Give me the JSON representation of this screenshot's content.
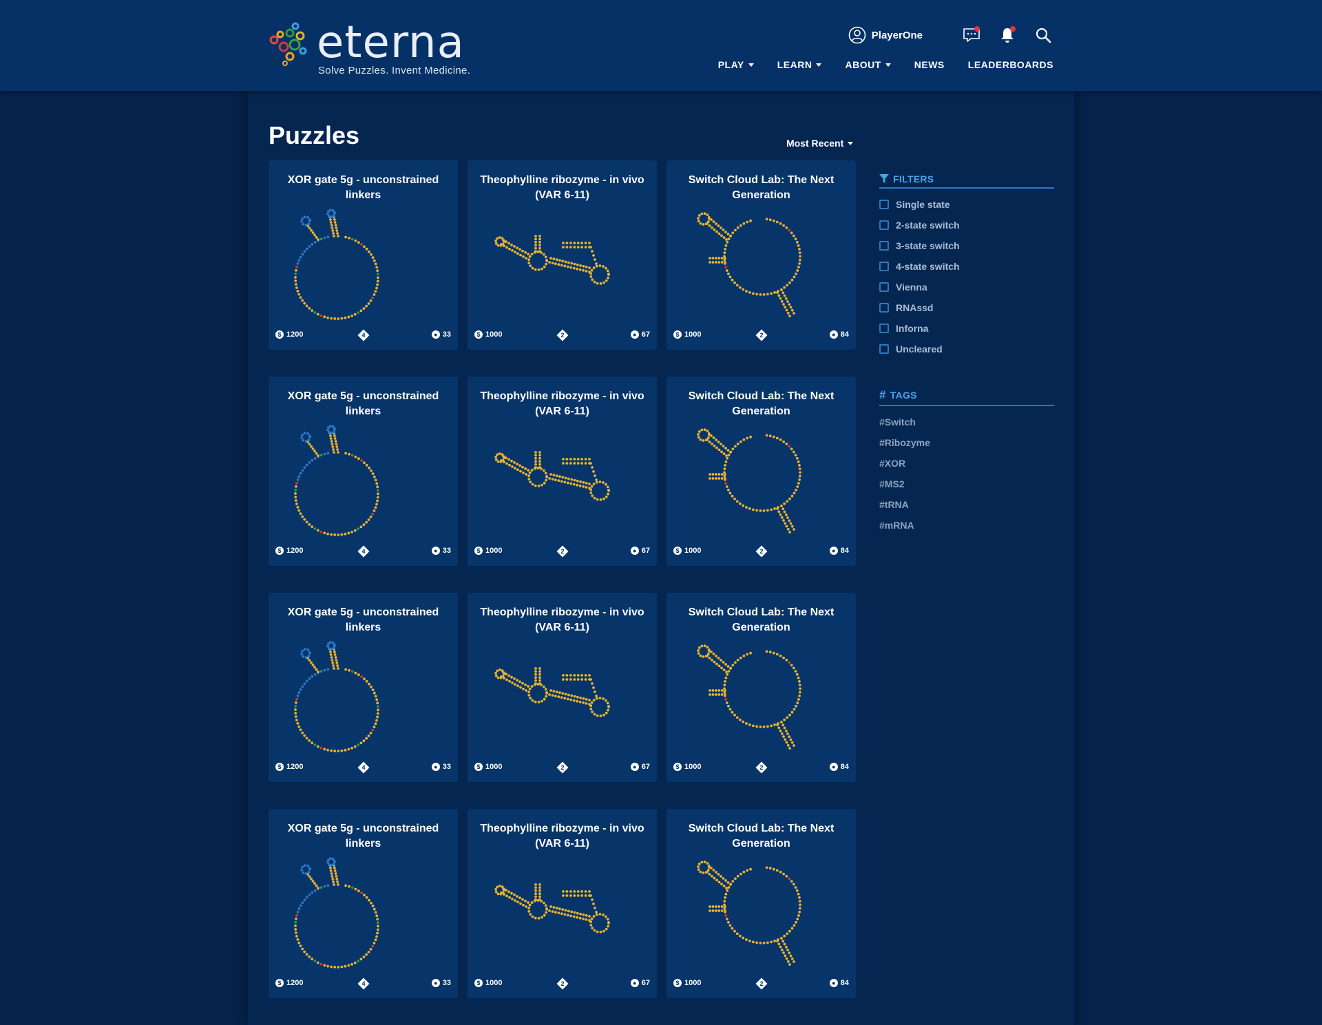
{
  "header": {
    "brand": "eterna",
    "tagline": "Solve Puzzles. Invent Medicine.",
    "username": "PlayerOne",
    "nav": [
      "PLAY",
      "LEARN",
      "ABOUT",
      "NEWS",
      "LEADERBOARDS"
    ]
  },
  "main": {
    "title": "Puzzles",
    "sort_label": "Most Recent"
  },
  "card_types": [
    {
      "title": "XOR gate 5g - unconstrained linkers",
      "reward": "1200",
      "states": "4",
      "players": "33",
      "art": "xor"
    },
    {
      "title": "Theophylline ribozyme - in vivo (VAR 6-11)",
      "reward": "1000",
      "states": "2",
      "players": "67",
      "art": "theo"
    },
    {
      "title": "Switch Cloud Lab: The Next Generation",
      "reward": "1000",
      "states": "2",
      "players": "84",
      "art": "switch"
    }
  ],
  "grid": {
    "rows": 4
  },
  "sidebar": {
    "filters_title": "FILTERS",
    "filters": [
      "Single state",
      "2-state switch",
      "3-state switch",
      "4-state switch",
      "Vienna",
      "RNAssd",
      "Inforna",
      "Uncleared"
    ],
    "tags_title": "TAGS",
    "tags": [
      "#Switch",
      "#Ribozyme",
      "#XOR",
      "#MS2",
      "#tRNA",
      "#mRNA"
    ]
  },
  "colors": {
    "page_bg": "#04224a",
    "header_bg": "#063166",
    "card_bg": "#073469",
    "accent": "#4aa3e8",
    "base_yellow": "#e8b230",
    "base_red": "#d8342c",
    "base_green": "#2f9a3e",
    "base_blue": "#2b78c7"
  }
}
